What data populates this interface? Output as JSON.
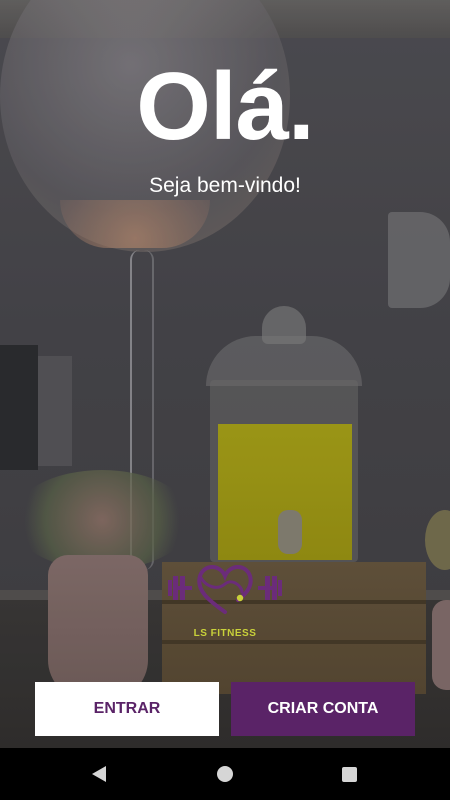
{
  "welcome": {
    "title": "Olá.",
    "subtitle": "Seja bem-vindo!"
  },
  "brand": {
    "name": "LS FITNESS",
    "logo_icon": "heart-dumbbell-logo",
    "primary_color": "#5a2367",
    "accent_color": "#c9d13a"
  },
  "actions": {
    "login_label": "ENTRAR",
    "signup_label": "CRIAR CONTA"
  },
  "navbar": {
    "back_icon": "back-triangle-icon",
    "home_icon": "home-circle-icon",
    "recents_icon": "recents-square-icon"
  }
}
